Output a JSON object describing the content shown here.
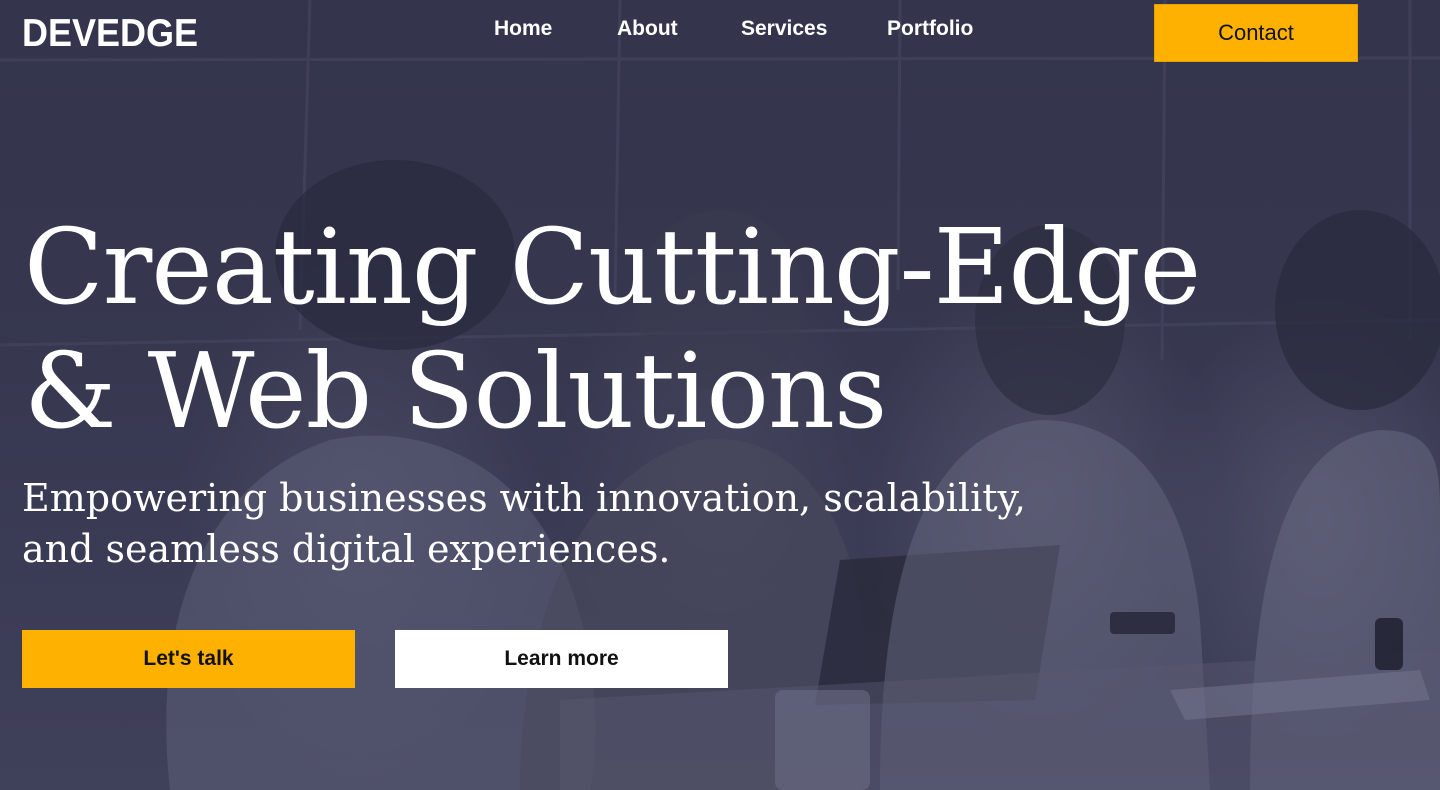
{
  "brand": {
    "logo_text": "DEVEDGE",
    "accent_color": "#ffb100"
  },
  "nav": {
    "items": [
      {
        "label": "Home"
      },
      {
        "label": "About"
      },
      {
        "label": "Services"
      },
      {
        "label": "Portfolio"
      }
    ],
    "contact_label": "Contact"
  },
  "hero": {
    "headline_line1": "Creating Cutting-Edge",
    "headline_line2": "& Web Solutions",
    "sub_line1": "Empowering businesses with innovation, scalability,",
    "sub_line2": "and seamless digital experiences.",
    "primary_cta": "Let's talk",
    "secondary_cta": "Learn more",
    "background_tint": "#34354d"
  }
}
